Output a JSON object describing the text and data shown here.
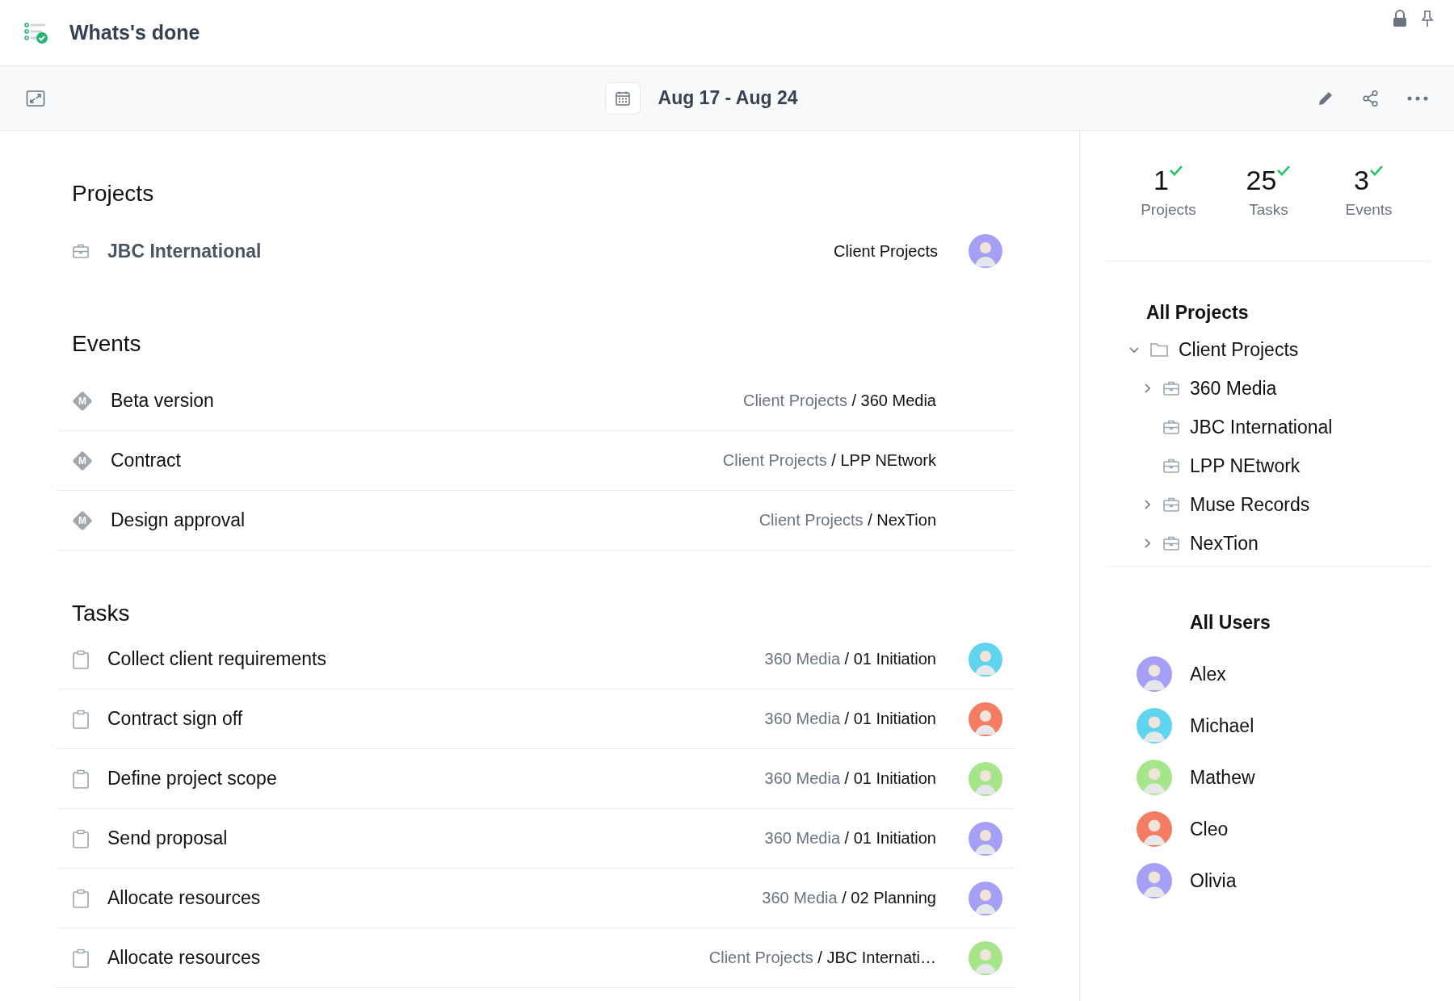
{
  "app": {
    "title": "Whats's done"
  },
  "toolbar": {
    "date_range": "Aug 17 - Aug 24"
  },
  "projects": {
    "heading": "Projects",
    "items": [
      {
        "name": "JBC International",
        "folder": "Client Projects",
        "color": "#a5a0f5"
      }
    ]
  },
  "events": {
    "heading": "Events",
    "items": [
      {
        "badge": "M",
        "name": "Beta version",
        "parent": "Client Projects",
        "child": "/ 360 Media"
      },
      {
        "badge": "M",
        "name": "Contract",
        "parent": "Client Projects",
        "child": "/ LPP NEtwork"
      },
      {
        "badge": "M",
        "name": "Design approval",
        "parent": "Client Projects",
        "child": "/ NexTion"
      }
    ]
  },
  "tasks": {
    "heading": "Tasks",
    "items": [
      {
        "name": "Collect client requirements",
        "parent": "360 Media",
        "child": "/ 01 Initiation",
        "color": "#5fd4ee"
      },
      {
        "name": "Contract sign off",
        "parent": "360 Media",
        "child": "/ 01 Initiation",
        "color": "#f47c63"
      },
      {
        "name": "Define project scope",
        "parent": "360 Media",
        "child": "/ 01 Initiation",
        "color": "#a6e58a"
      },
      {
        "name": "Send proposal",
        "parent": "360 Media",
        "child": "/ 01 Initiation",
        "color": "#a5a0f5"
      },
      {
        "name": "Allocate resources",
        "parent": "360 Media",
        "child": "/ 02 Planning",
        "color": "#a5a0f5"
      },
      {
        "name": "Allocate resources",
        "parent": "Client Projects",
        "child": "/ JBC Internati…",
        "color": "#a6e58a"
      }
    ]
  },
  "summary": [
    {
      "count": "1",
      "label": "Projects"
    },
    {
      "count": "25",
      "label": "Tasks"
    },
    {
      "count": "3",
      "label": "Events"
    }
  ],
  "all_projects": {
    "heading": "All Projects",
    "tree": [
      {
        "name": "Client Projects",
        "kind": "folder",
        "expanded": true,
        "children": [
          {
            "name": "360 Media",
            "kind": "project",
            "expanded": false
          },
          {
            "name": "JBC International",
            "kind": "project"
          },
          {
            "name": "LPP NEtwork",
            "kind": "project"
          },
          {
            "name": "Muse Records",
            "kind": "project",
            "expanded": false
          },
          {
            "name": "NexTion",
            "kind": "project",
            "expanded": false
          }
        ]
      }
    ]
  },
  "all_users": {
    "heading": "All Users",
    "users": [
      {
        "name": "Alex",
        "color": "#a5a0f5"
      },
      {
        "name": "Michael",
        "color": "#5fd4ee"
      },
      {
        "name": "Mathew",
        "color": "#a6e58a"
      },
      {
        "name": "Cleo",
        "color": "#f47c63"
      },
      {
        "name": "Olivia",
        "color": "#a5a0f5"
      }
    ]
  }
}
